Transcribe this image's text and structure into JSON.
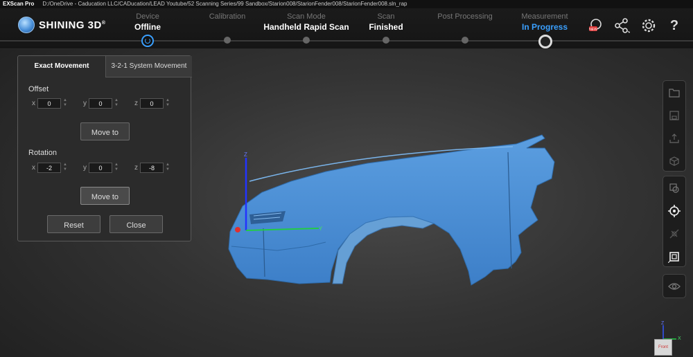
{
  "titlebar": {
    "app": "EXScan Pro",
    "path": "D:/OneDrive - Caducation LLC/CADucation/LEAD Youtube/52 Scanning Series/99 Sandbox/Starion008/StarionFender008/StarionFender008.sln_rap"
  },
  "logo": {
    "text": "SHINING 3D",
    "mark": "®"
  },
  "steps": [
    {
      "label": "Device",
      "value": "Offline"
    },
    {
      "label": "Calibration",
      "value": ""
    },
    {
      "label": "Scan Mode",
      "value": "Handheld Rapid Scan"
    },
    {
      "label": "Scan",
      "value": "Finished"
    },
    {
      "label": "Post Processing",
      "value": ""
    },
    {
      "label": "Measurement",
      "value": "In Progress"
    }
  ],
  "toolbar_icons": [
    "new-badge-icon",
    "share-icon",
    "settings-icon",
    "help-icon"
  ],
  "dialog": {
    "tab_active": "Exact Movement",
    "tab_inactive": "3-2-1 System  Movement",
    "offset_label": "Offset",
    "offset": {
      "x_label": "x",
      "x": "0",
      "y_label": "y",
      "y": "0",
      "z_label": "z",
      "z": "0"
    },
    "move_to_1": "Move to",
    "rotation_label": "Rotation",
    "rotation": {
      "x_label": "x",
      "x": "-2",
      "y_label": "y",
      "y": "0",
      "z_label": "z",
      "z": "-8"
    },
    "move_to_2": "Move to",
    "reset": "Reset",
    "close": "Close"
  },
  "axes": {
    "x": "X",
    "y": "Y",
    "z": "Z"
  },
  "view_cube": {
    "z": "Z",
    "x": "X",
    "face": "Front"
  },
  "colors": {
    "accent": "#3aa0ff",
    "scan": "#4a8fd6",
    "panel": "#2b2b2b"
  }
}
